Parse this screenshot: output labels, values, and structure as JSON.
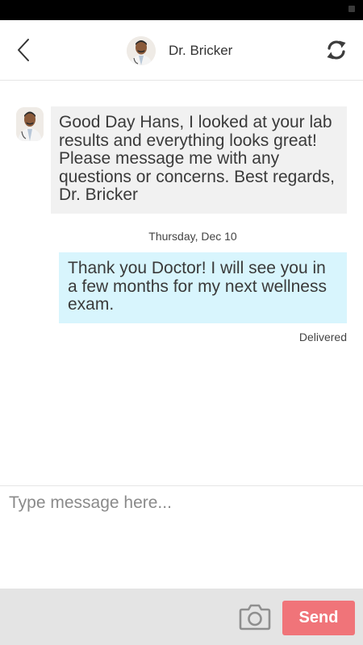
{
  "header": {
    "back_icon": "chevron-left-icon",
    "title": "Dr. Bricker",
    "avatar": "doctor-avatar",
    "refresh_icon": "refresh-icon"
  },
  "thread": {
    "messages": [
      {
        "direction": "incoming",
        "avatar": "doctor-avatar",
        "text": "Good Day Hans, I looked at your lab results and everything looks great! Please message me with any questions or concerns. Best regards, Dr. Bricker"
      },
      {
        "direction": "outgoing",
        "date": "Thursday, Dec 10",
        "text": "Thank you Doctor! I will see you in a few months for my next wellness exam.",
        "status": "Delivered"
      }
    ]
  },
  "composer": {
    "placeholder": "Type message here...",
    "value": ""
  },
  "bottombar": {
    "camera_icon": "camera-icon",
    "send_label": "Send"
  },
  "colors": {
    "incoming_bubble": "#f1f1f1",
    "outgoing_bubble": "#d8f5fd",
    "send_button": "#f07479",
    "bottom_bar": "#e4e4e4"
  }
}
